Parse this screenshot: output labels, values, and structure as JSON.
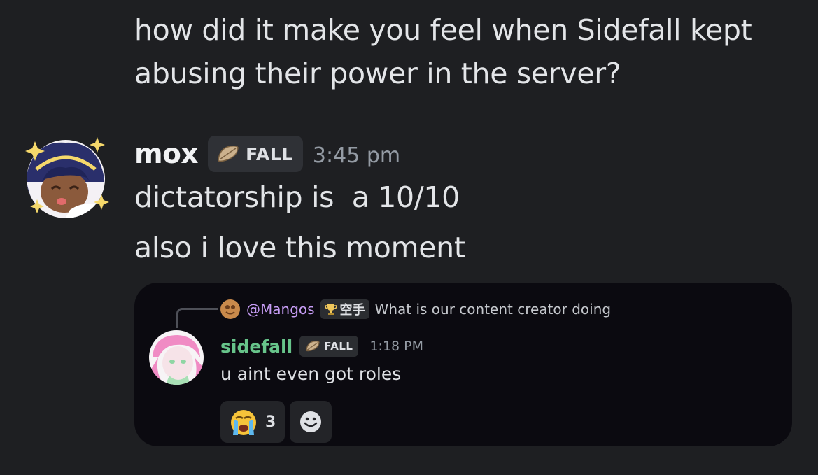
{
  "previous_message": {
    "text_line1": "how did it make you feel when Sidefall kept",
    "text_line2": "abusing their power in the server?"
  },
  "message": {
    "username": "mox",
    "tag": "FALL",
    "tag_icon": "leaf-icon",
    "timestamp": "3:45 pm",
    "lines": [
      "dictatorship is  a 10/10",
      "also i love this moment"
    ]
  },
  "embed": {
    "reply": {
      "username": "@Mangos",
      "tag_icon": "trophy-icon",
      "tag": "空手",
      "content": "What is our content creator doing"
    },
    "username": "sidefall",
    "username_color": "#67c48a",
    "tag": "FALL",
    "tag_icon": "leaf-icon",
    "timestamp": "1:18 PM",
    "content": "u aint even got roles",
    "reactions": [
      {
        "emoji": "loudly-crying-face-icon",
        "count": "3"
      }
    ],
    "add_reaction_icon": "smiley-add-reaction-icon"
  },
  "colors": {
    "background": "#1e1f22",
    "embed_background": "#0b0a10",
    "reply_username": "#c79df5",
    "timestamp": "#949ba4"
  }
}
